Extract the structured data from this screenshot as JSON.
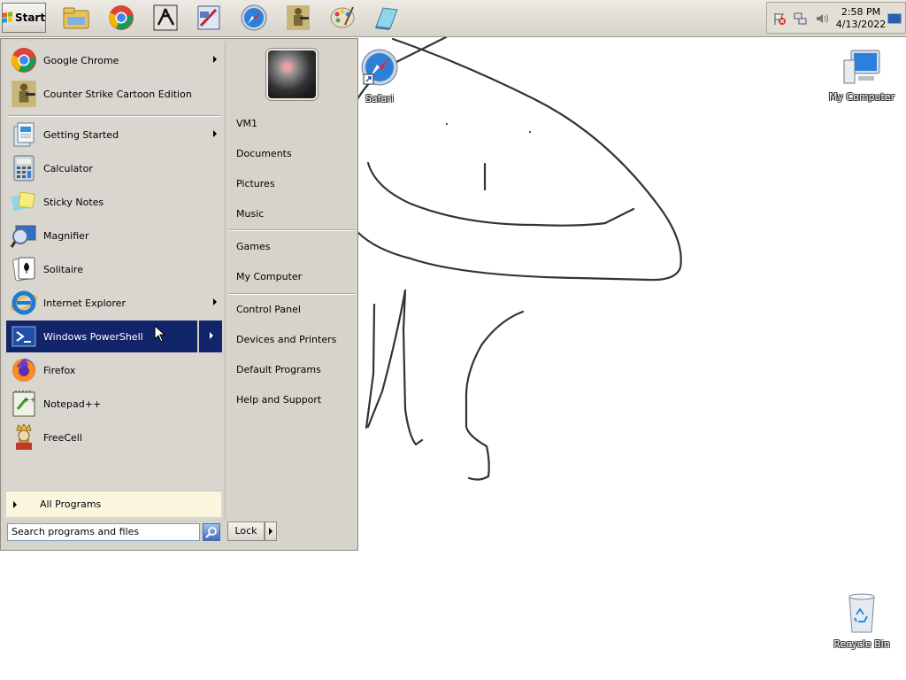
{
  "taskbar": {
    "start_label": "Start",
    "pinned": [
      {
        "name": "explorer-icon"
      },
      {
        "name": "chrome-icon"
      },
      {
        "name": "counter-strike-icon"
      },
      {
        "name": "paint-tool-icon"
      },
      {
        "name": "safari-icon"
      },
      {
        "name": "soldier-game-icon"
      },
      {
        "name": "paint-palette-icon"
      },
      {
        "name": "notepad-icon"
      }
    ],
    "clock_time": "2:58 PM",
    "clock_date": "4/13/2022"
  },
  "desktop": {
    "icons": [
      {
        "label": "Safari"
      },
      {
        "label": "My Computer"
      },
      {
        "label": "Recycle Bin"
      }
    ]
  },
  "start_menu": {
    "programs": [
      {
        "label": "Google Chrome",
        "has_submenu": true
      },
      {
        "label": "Counter Strike Cartoon Edition",
        "has_submenu": false
      },
      {
        "label": "Getting Started",
        "has_submenu": true
      },
      {
        "label": "Calculator",
        "has_submenu": false
      },
      {
        "label": "Sticky Notes",
        "has_submenu": false
      },
      {
        "label": "Magnifier",
        "has_submenu": false
      },
      {
        "label": "Solitaire",
        "has_submenu": false
      },
      {
        "label": "Internet Explorer",
        "has_submenu": true
      },
      {
        "label": "Windows PowerShell",
        "has_submenu": true,
        "highlighted": true
      },
      {
        "label": "Firefox",
        "has_submenu": false
      },
      {
        "label": "Notepad++",
        "has_submenu": false
      },
      {
        "label": "FreeCell",
        "has_submenu": false
      }
    ],
    "all_programs": "All Programs",
    "search_placeholder": "Search programs and files",
    "right_items": [
      "VM1",
      "Documents",
      "Pictures",
      "Music",
      "Games",
      "My Computer",
      "Control Panel",
      "Devices and Printers",
      "Default Programs",
      "Help and Support"
    ],
    "lock_label": "Lock"
  },
  "colors": {
    "highlight": "#13256a",
    "menu_bg": "#d6d3cb",
    "all_programs_bg": "#fbf7df"
  }
}
